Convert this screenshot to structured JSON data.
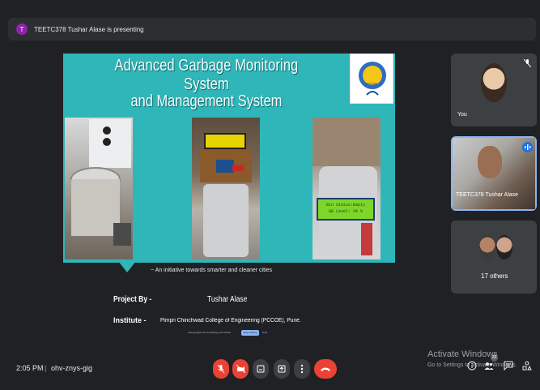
{
  "banner": {
    "avatar_letter": "T",
    "text": "TEETC378 Tushar Alase is presenting"
  },
  "slide": {
    "title_line1": "Advanced Garbage Monitoring System",
    "title_line2": "and Management System",
    "logo_text": "PCCOE",
    "lcd_text": "Bin Status:Empty\nGB Level: 4% %",
    "tagline": "~ An initiative towards smarter and cleaner cities",
    "project_label": "Project By -",
    "project_name": "Tushar Alase",
    "institute_label": "Institute -",
    "institute_value": "Pimpri Chinchwad College of Engineering (PCCOE), Pune.",
    "present_note": "meet.google.com is sharing your screen",
    "stop_label": "Stop sharing",
    "hide_label": "Hide"
  },
  "participants": {
    "you": {
      "label": "You"
    },
    "presenter": {
      "label": "TEETC378 Tushar Alase"
    },
    "others": {
      "label": "17 others"
    }
  },
  "bottom": {
    "time": "2:05 PM",
    "separator": "|",
    "meeting_code": "ohv-znys-gig",
    "people_count": "20"
  },
  "watermark": {
    "line1": "Activate Windows",
    "line2": "Go to Settings to activate Windows."
  },
  "colors": {
    "slide_bg": "#2fb6b9",
    "end_call": "#ea4335",
    "accent": "#8ab4f8"
  }
}
